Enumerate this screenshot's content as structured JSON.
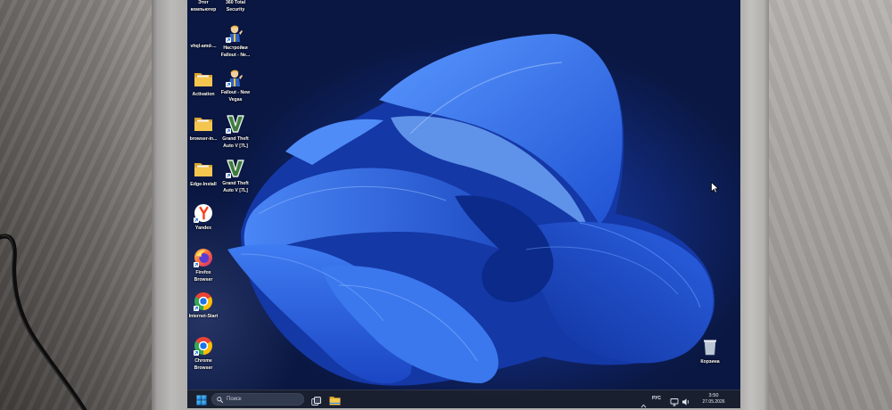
{
  "desktop": {
    "icons": [
      {
        "lines": [
          "Этот",
          "компьютер"
        ]
      },
      {
        "lines": [
          "vhql-amd-..."
        ]
      },
      {
        "icon": "folder-icon",
        "lines": [
          "Activation"
        ]
      },
      {
        "icon": "folder-icon",
        "lines": [
          "browser-in..."
        ]
      },
      {
        "icon": "folder-icon",
        "lines": [
          "Edge-Install"
        ]
      },
      {
        "icon": "yandex-icon",
        "lines": [
          "Yandex"
        ]
      },
      {
        "icon": "firefox-icon",
        "lines": [
          "Firefox",
          "Browser"
        ]
      },
      {
        "icon": "chrome-icon",
        "lines": [
          "Internet-Start"
        ]
      },
      {
        "icon": "chrome-icon",
        "lines": [
          "Chrome",
          "Browser"
        ]
      },
      {
        "lines": [
          "360 Total",
          "Security"
        ]
      },
      {
        "icon": "vault-boy-icon",
        "lines": [
          "Настройки",
          "Fallout - Ne..."
        ]
      },
      {
        "icon": "vault-boy-icon",
        "lines": [
          "Fallout - New",
          "Vegas"
        ]
      },
      {
        "icon": "gta-v-icon",
        "lines": [
          "Grand Theft",
          "Auto V [7L]"
        ]
      },
      {
        "icon": "gta-v-icon",
        "lines": [
          "Grand Theft",
          "Auto V [7L]"
        ]
      }
    ],
    "recycle_bin": {
      "icon": "recycle-bin-icon",
      "lines": [
        "Корзина"
      ]
    }
  },
  "taskbar": {
    "start_icon": "windows-logo-icon",
    "search_placeholder": "Поиск",
    "pinned": [
      "task-view-icon",
      "file-explorer-icon"
    ],
    "tray": {
      "language": "РУС",
      "icons": [
        "chevron-up-icon",
        "network-icon",
        "volume-icon"
      ],
      "time": "3:50",
      "date": "27.05.2026"
    }
  },
  "colors": {
    "wallpaper_accent": "#3b78ee",
    "wallpaper_background": "#0a1742",
    "taskbar_background": "#1b202e",
    "folder": "#f4c64f"
  }
}
